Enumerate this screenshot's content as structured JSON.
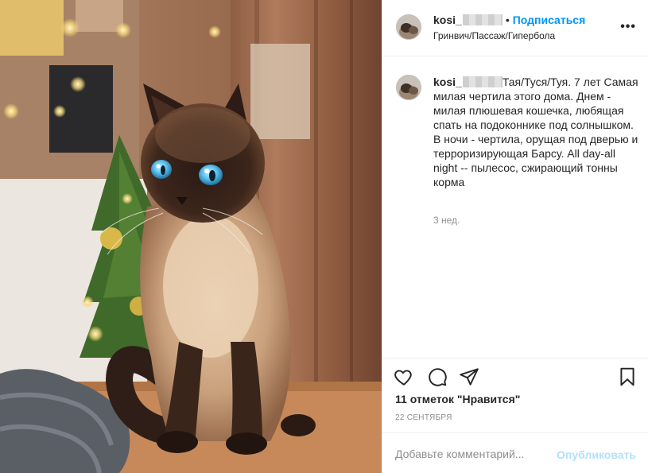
{
  "post": {
    "username": "kosi_",
    "separator": "•",
    "follow_label": "Подписаться",
    "location": "Гринвич/Пассаж/Гипербола",
    "more_icon": "more-horizontal-icon",
    "more_label": "•••"
  },
  "caption": {
    "username": "kosi_",
    "text": "Тая/Туся/Туя. 7 лет Самая милая чертила этого дома. Днем - милая плюшевая кошечка, любящая спать на подоконнике под солнышком. В ночи - чертила, орущая под дверью и терроризирующая Барсу. All day-all night -- пылесос, сжирающий тонны корма",
    "time": "3 нед."
  },
  "actions": {
    "like_icon": "heart-icon",
    "comment_icon": "comment-icon",
    "share_icon": "paper-plane-icon",
    "save_icon": "bookmark-icon"
  },
  "likes_label": "11 отметок \"Нравится\"",
  "date_label": "22 сентября",
  "comment_form": {
    "placeholder": "Добавьте комментарий...",
    "publish_label": "Опубликовать"
  },
  "colors": {
    "link": "#0095f6",
    "publish_disabled": "#b2dffc",
    "secondary_text": "#8e8e8e",
    "border": "#efefef"
  }
}
